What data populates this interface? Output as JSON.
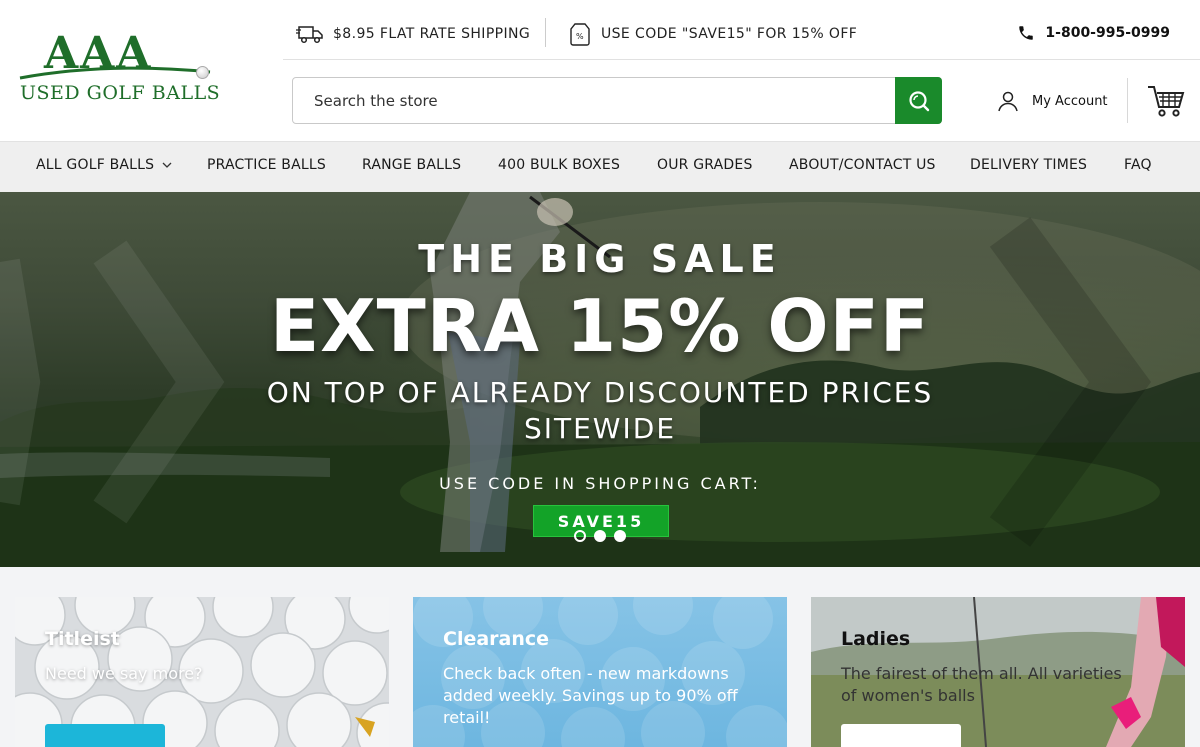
{
  "header": {
    "logo": {
      "top": "AAA",
      "name": "USED GOLF BALLS"
    },
    "shipping_text": "$8.95 FLAT RATE SHIPPING",
    "promo_text": "USE CODE \"SAVE15\" FOR 15% OFF",
    "phone": "1-800-995-0999",
    "search_placeholder": "Search the store",
    "account_label": "My Account"
  },
  "nav": {
    "items": [
      {
        "label": "ALL GOLF BALLS",
        "has_dropdown": true
      },
      {
        "label": "PRACTICE BALLS"
      },
      {
        "label": "RANGE BALLS"
      },
      {
        "label": "400 BULK BOXES"
      },
      {
        "label": "OUR GRADES"
      },
      {
        "label": "ABOUT/CONTACT US"
      },
      {
        "label": "DELIVERY TIMES"
      },
      {
        "label": "FAQ"
      }
    ]
  },
  "hero": {
    "line1": "THE BIG SALE",
    "line2": "EXTRA 15% OFF",
    "line3a": "ON TOP OF ALREADY DISCOUNTED PRICES",
    "line3b": "SITEWIDE",
    "line4": "USE CODE IN SHOPPING CART:",
    "code": "SAVE15",
    "slide_count": 3,
    "active_slide": 1
  },
  "cards": [
    {
      "title": "Titleist",
      "desc": "Need we say more?"
    },
    {
      "title": "Clearance",
      "desc": "Check back often - new markdowns added weekly. Savings up to 90% off retail!"
    },
    {
      "title": "Ladies",
      "desc": "The fairest of them all. All varieties of women's balls"
    }
  ],
  "colors": {
    "brand_green": "#1f6e2a",
    "search_button": "#1a8a2b",
    "code_badge": "#13a328",
    "card_button_blue": "#1cb6d9"
  }
}
